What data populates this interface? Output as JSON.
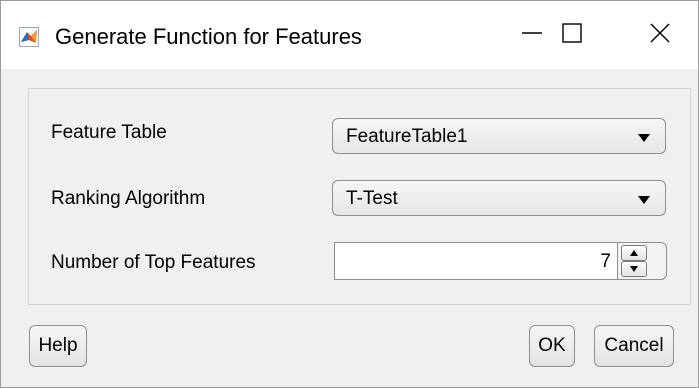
{
  "window": {
    "title": "Generate Function for Features",
    "icon": "matlab-membrane-icon",
    "controls": {
      "minimize": "minimize-icon",
      "maximize": "maximize-icon",
      "close": "close-icon"
    }
  },
  "form": {
    "feature_table": {
      "label": "Feature Table",
      "value": "FeatureTable1"
    },
    "ranking_algorithm": {
      "label": "Ranking Algorithm",
      "value": "T-Test"
    },
    "top_features": {
      "label": "Number of Top Features",
      "value": "7"
    }
  },
  "buttons": {
    "help": "Help",
    "ok": "OK",
    "cancel": "Cancel"
  },
  "colors": {
    "titlebar_bg": "#ffffff",
    "dialog_bg": "#f0f0f0",
    "icon_orange": "#d9531e",
    "icon_blue": "#2a6ebb"
  }
}
